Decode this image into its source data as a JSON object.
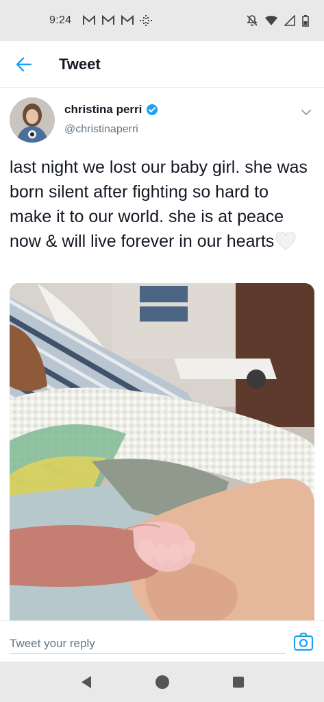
{
  "status_bar": {
    "time": "9:24",
    "notification_icons": [
      "gmail-icon",
      "gmail-icon",
      "gmail-icon",
      "slack-icon"
    ],
    "right_icons": [
      "mute-icon",
      "wifi-icon",
      "signal-icon",
      "battery-icon"
    ]
  },
  "header": {
    "back_icon": "arrow-left-icon",
    "title": "Tweet",
    "accent_color": "#1da1f2"
  },
  "tweet": {
    "author_name": "christina perri",
    "verified": true,
    "handle": "@christinaperri",
    "text": "last night we lost our baby girl. she was born silent after fighting so hard to make it to our world. she is at peace now & will live forever in our hearts",
    "emoji": "white-heart-icon",
    "media": "photo"
  },
  "reply": {
    "placeholder": "Tweet your reply",
    "camera_icon": "camera-icon"
  },
  "nav_bar": {
    "back": "back-triangle-icon",
    "home": "home-circle-icon",
    "recents": "recents-square-icon"
  }
}
